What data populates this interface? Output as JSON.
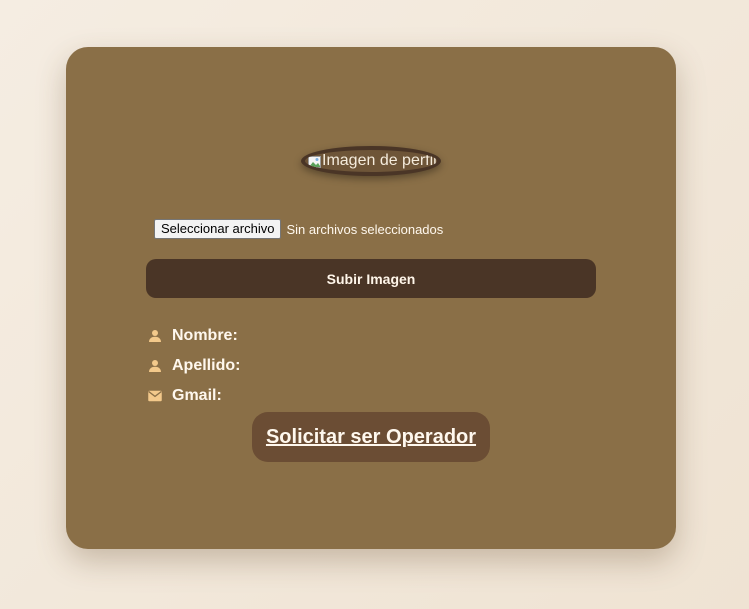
{
  "profile": {
    "image_alt": "Imagen de perfil"
  },
  "upload": {
    "choose_file_label": "Seleccionar archivo",
    "file_status": "Sin archivos seleccionados",
    "submit_label": "Subir Imagen"
  },
  "info": {
    "items": [
      {
        "icon": "person-icon",
        "label": "Nombre:"
      },
      {
        "icon": "person-icon",
        "label": "Apellido:"
      },
      {
        "icon": "mail-icon",
        "label": "Gmail:"
      }
    ]
  },
  "actions": {
    "request_operator_label": "Solicitar ser Operador"
  },
  "colors": {
    "card": "#8a6f47",
    "dark_button": "#4a3526",
    "operator_button": "#6b4d34",
    "icon": "#f3c98b"
  }
}
